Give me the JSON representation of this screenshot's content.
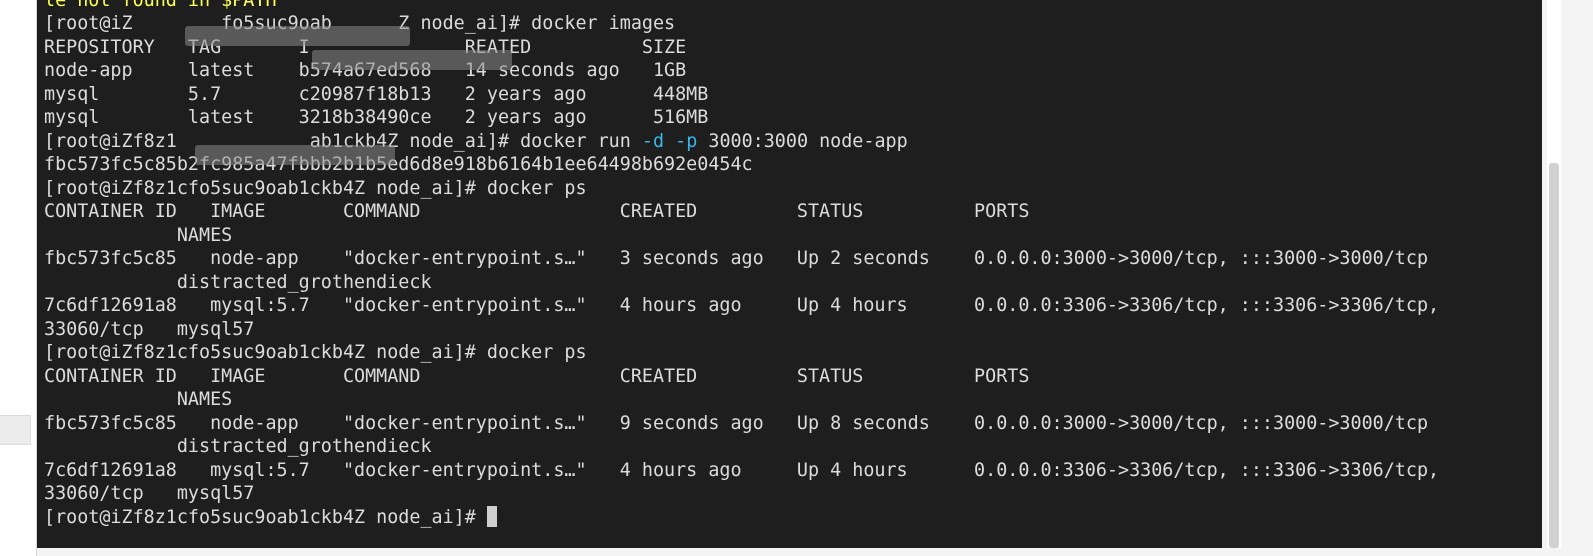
{
  "terminal": {
    "lines": [
      {
        "id": "l0",
        "parts": [
          {
            "text": "le not found in $PATH",
            "color": "yellow"
          }
        ]
      },
      {
        "id": "l1",
        "parts": [
          {
            "text": "[root@iZ        fo5suc9oab      Z node_ai]# docker images",
            "color": "default"
          }
        ]
      },
      {
        "id": "l2",
        "parts": [
          {
            "text": "REPOSITORY   TAG       I              REATED          SIZE",
            "color": "default"
          }
        ]
      },
      {
        "id": "l3",
        "parts": [
          {
            "text": "node-app     latest    b574a67ed568   14 seconds ago   1GB",
            "color": "default"
          }
        ]
      },
      {
        "id": "l4",
        "parts": [
          {
            "text": "mysql        5.7       c20987f18b13   2 years ago      448MB",
            "color": "default"
          }
        ]
      },
      {
        "id": "l5",
        "parts": [
          {
            "text": "mysql        latest    3218b38490ce   2 years ago      516MB",
            "color": "default"
          }
        ]
      },
      {
        "id": "l6",
        "parts": [
          {
            "text": "[root@iZf8z1            ab1ckb4Z node_ai]# docker run ",
            "color": "default"
          },
          {
            "text": "-d",
            "color": "cyan"
          },
          {
            "text": " ",
            "color": "default"
          },
          {
            "text": "-p",
            "color": "cyan"
          },
          {
            "text": " 3000:3000 node-app",
            "color": "default"
          }
        ]
      },
      {
        "id": "l7",
        "parts": [
          {
            "text": "fbc573fc5c85b2fc985a47fbbb2b1b5ed6d8e918b6164b1ee64498b692e0454c",
            "color": "default"
          }
        ]
      },
      {
        "id": "l8",
        "parts": [
          {
            "text": "[root@iZf8z1cfo5suc9oab1ckb4Z node_ai]# docker ps",
            "color": "default"
          }
        ]
      },
      {
        "id": "l9",
        "parts": [
          {
            "text": "CONTAINER ID   IMAGE       COMMAND                  CREATED         STATUS          PORTS",
            "color": "default"
          }
        ]
      },
      {
        "id": "l10",
        "parts": [
          {
            "text": "            NAMES",
            "color": "default"
          }
        ]
      },
      {
        "id": "l11",
        "parts": [
          {
            "text": "fbc573fc5c85   node-app    \"docker-entrypoint.s…\"   3 seconds ago   Up 2 seconds    0.0.0.0:3000->3000/tcp, :::3000->3000/tcp",
            "color": "default"
          }
        ]
      },
      {
        "id": "l12",
        "parts": [
          {
            "text": "            distracted_grothendieck",
            "color": "default"
          }
        ]
      },
      {
        "id": "l13",
        "parts": [
          {
            "text": "7c6df12691a8   mysql:5.7   \"docker-entrypoint.s…\"   4 hours ago     Up 4 hours      0.0.0.0:3306->3306/tcp, :::3306->3306/tcp,",
            "color": "default"
          }
        ]
      },
      {
        "id": "l14",
        "parts": [
          {
            "text": "33060/tcp   mysql57",
            "color": "default"
          }
        ]
      },
      {
        "id": "l15",
        "parts": [
          {
            "text": "[root@iZf8z1cfo5suc9oab1ckb4Z node_ai]# docker ps",
            "color": "default"
          }
        ]
      },
      {
        "id": "l16",
        "parts": [
          {
            "text": "CONTAINER ID   IMAGE       COMMAND                  CREATED         STATUS          PORTS",
            "color": "default"
          }
        ]
      },
      {
        "id": "l17",
        "parts": [
          {
            "text": "            NAMES",
            "color": "default"
          }
        ]
      },
      {
        "id": "l18",
        "parts": [
          {
            "text": "fbc573fc5c85   node-app    \"docker-entrypoint.s…\"   9 seconds ago   Up 8 seconds    0.0.0.0:3000->3000/tcp, :::3000->3000/tcp",
            "color": "default"
          }
        ]
      },
      {
        "id": "l19",
        "parts": [
          {
            "text": "            distracted_grothendieck",
            "color": "default"
          }
        ]
      },
      {
        "id": "l20",
        "parts": [
          {
            "text": "7c6df12691a8   mysql:5.7   \"docker-entrypoint.s…\"   4 hours ago     Up 4 hours      0.0.0.0:3306->3306/tcp, :::3306->3306/tcp,",
            "color": "default"
          }
        ]
      },
      {
        "id": "l21",
        "parts": [
          {
            "text": "33060/tcp   mysql57",
            "color": "default"
          }
        ]
      },
      {
        "id": "l22",
        "parts": [
          {
            "text": "[root@iZf8z1cfo5suc9oab1ckb4Z node_ai]# ",
            "color": "default"
          }
        ],
        "cursor": true
      }
    ]
  },
  "colors": {
    "background": "#1e1e1e",
    "text": "#dcdcdc",
    "yellow": "#ffff55",
    "cyan": "#3bb6ea"
  }
}
